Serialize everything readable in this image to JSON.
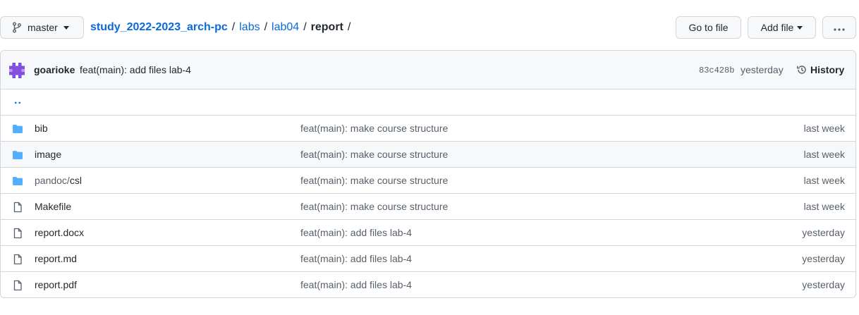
{
  "branch": {
    "label": "master"
  },
  "breadcrumb": {
    "repo": "study_2022-2023_arch-pc",
    "sep": "/",
    "path": [
      "labs",
      "lab04"
    ],
    "current": "report"
  },
  "actions": {
    "goto_file": "Go to file",
    "add_file": "Add file",
    "more": "···"
  },
  "commit": {
    "author": "goarioke",
    "message": "feat(main): add files lab-4",
    "sha": "83c428b",
    "time": "yesterday",
    "history_label": "History"
  },
  "parent_link": "..",
  "files": [
    {
      "type": "folder",
      "prefix": "",
      "name": "bib",
      "message": "feat(main): make course structure",
      "age": "last week"
    },
    {
      "type": "folder",
      "prefix": "",
      "name": "image",
      "message": "feat(main): make course structure",
      "age": "last week"
    },
    {
      "type": "folder",
      "prefix": "pandoc/",
      "name": "csl",
      "message": "feat(main): make course structure",
      "age": "last week"
    },
    {
      "type": "file",
      "prefix": "",
      "name": "Makefile",
      "message": "feat(main): make course structure",
      "age": "last week"
    },
    {
      "type": "file",
      "prefix": "",
      "name": "report.docx",
      "message": "feat(main): add files lab-4",
      "age": "yesterday"
    },
    {
      "type": "file",
      "prefix": "",
      "name": "report.md",
      "message": "feat(main): add files lab-4",
      "age": "yesterday"
    },
    {
      "type": "file",
      "prefix": "",
      "name": "report.pdf",
      "message": "feat(main): add files lab-4",
      "age": "yesterday"
    }
  ],
  "colors": {
    "folder": "#54aeff",
    "link": "#0969da",
    "avatar": "#8250df"
  }
}
